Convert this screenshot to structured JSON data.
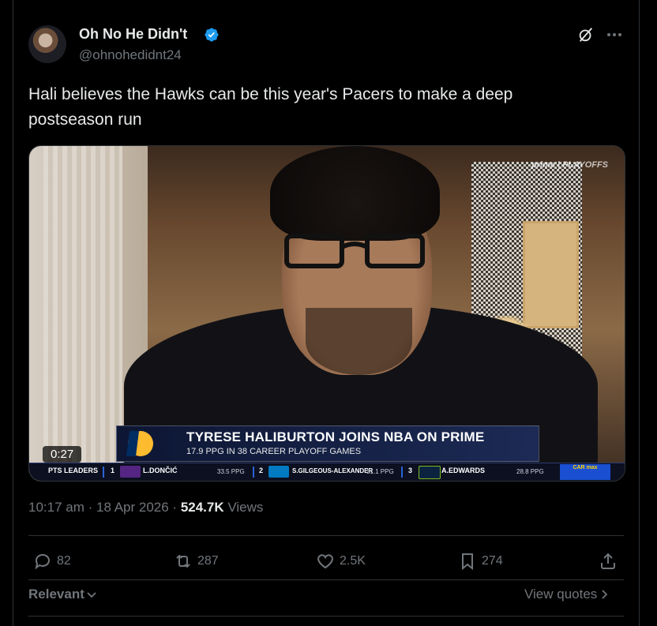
{
  "author": {
    "name": "Oh No He Didn't",
    "handle": "@ohnohedidnt24",
    "verified": true,
    "verified_color": "#1d9bf0"
  },
  "tweet": {
    "text": "Hali believes the Hawks can be this year's Pacers to make a deep postseason run"
  },
  "video": {
    "duration": "0:27",
    "watermark": "prime",
    "watermark_tag": "PLAYOFFS",
    "lower_third": {
      "title": "TYRESE HALIBURTON JOINS NBA ON PRIME",
      "subtitle": "17.9 PPG IN 38 CAREER PLAYOFF GAMES"
    },
    "ticker": {
      "label": "PTS LEADERS",
      "leaders": [
        {
          "rank": "1",
          "name": "L.DONČIĆ",
          "stat": "33.5 PPG",
          "team_color": "#552583"
        },
        {
          "rank": "2",
          "name": "S.GILGEOUS-ALEXANDER",
          "stat": "31.1 PPG",
          "team_color": "#007ac1"
        },
        {
          "rank": "3",
          "name": "A.EDWARDS",
          "stat": "28.8 PPG",
          "team_color": "#0c2340"
        }
      ],
      "sponsor": "CAR max"
    }
  },
  "meta": {
    "time": "10:17 am",
    "date": "18 Apr 2026",
    "views_count": "524.7K",
    "views_label": "Views"
  },
  "actions": {
    "replies": "82",
    "reposts": "287",
    "likes": "2.5K",
    "bookmarks": "274"
  },
  "footer": {
    "sort_label": "Relevant",
    "view_quotes": "View quotes"
  },
  "icons": [
    "grok-icon",
    "more-icon",
    "verified-icon",
    "reply-icon",
    "repost-icon",
    "like-icon",
    "bookmark-icon",
    "share-icon",
    "chevron-down-icon",
    "chevron-right-icon"
  ]
}
